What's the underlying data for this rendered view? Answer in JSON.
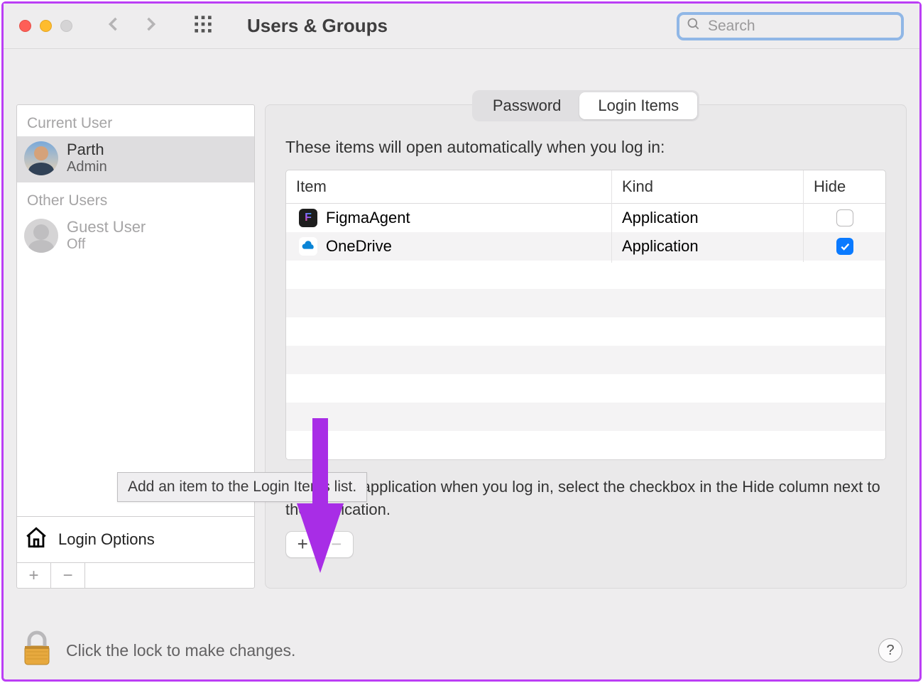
{
  "toolbar": {
    "title": "Users & Groups",
    "search_placeholder": "Search"
  },
  "sidebar": {
    "section_current": "Current User",
    "section_other": "Other Users",
    "current_user": {
      "name": "Parth",
      "role": "Admin"
    },
    "other_user": {
      "name": "Guest User",
      "role": "Off"
    },
    "login_options_label": "Login Options"
  },
  "tabs": {
    "password": "Password",
    "login_items": "Login Items"
  },
  "panel": {
    "description": "These items will open automatically when you log in:",
    "columns": {
      "item": "Item",
      "kind": "Kind",
      "hide": "Hide"
    },
    "rows": [
      {
        "icon": "figma",
        "name": "FigmaAgent",
        "kind": "Application",
        "hide": false
      },
      {
        "icon": "onedrive",
        "name": "OneDrive",
        "kind": "Application",
        "hide": true
      }
    ],
    "hint": "To hide an application when you log in, select the checkbox in the Hide column next to the application."
  },
  "tooltip": "Add an item to the Login Items list.",
  "footer": {
    "text": "Click the lock to make changes."
  }
}
